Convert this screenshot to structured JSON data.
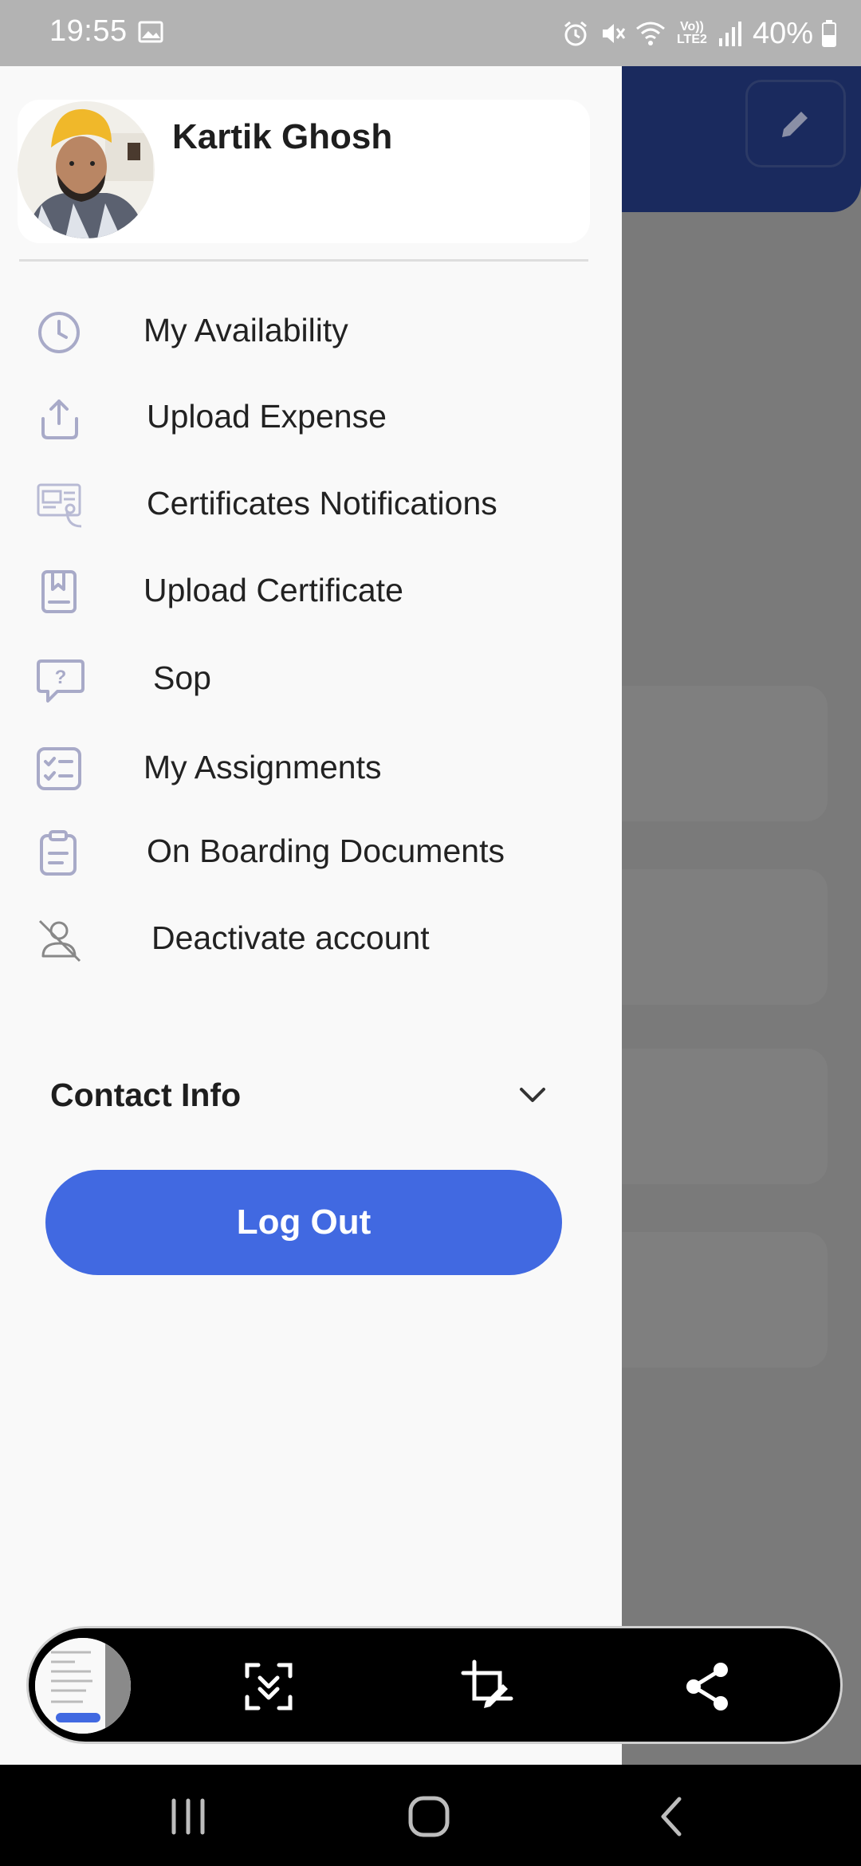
{
  "status_bar": {
    "time": "19:55",
    "battery": "40%",
    "network": "Vo)) LTE2",
    "icons": [
      "image-icon",
      "alarm-icon",
      "mute-icon",
      "wifi-icon",
      "signal-icon",
      "battery-icon"
    ]
  },
  "background_app": {
    "header_color": "#1a2a5e",
    "edit_icon": "pencil-icon"
  },
  "drawer": {
    "profile": {
      "name": "Kartik Ghosh",
      "avatar": "avatar-photo"
    },
    "menu": [
      {
        "label": "My Availability",
        "icon": "clock-icon"
      },
      {
        "label": "Upload Expense",
        "icon": "upload-icon"
      },
      {
        "label": "Certificates Notifications",
        "icon": "certificate-notification-icon"
      },
      {
        "label": "Upload Certificate",
        "icon": "certificate-icon"
      },
      {
        "label": "Sop",
        "icon": "help-chat-icon"
      },
      {
        "label": "My Assignments",
        "icon": "checklist-icon"
      },
      {
        "label": "On Boarding Documents",
        "icon": "clipboard-icon"
      },
      {
        "label": "Deactivate account",
        "icon": "user-off-icon"
      }
    ],
    "contact_info": {
      "label": "Contact Info",
      "icon": "chevron-down-icon"
    },
    "logout": {
      "label": "Log Out",
      "color": "#4169e1"
    }
  },
  "screenshot_toolbar": {
    "tools": [
      "scroll-capture-icon",
      "crop-edit-icon",
      "share-icon"
    ]
  },
  "nav_bar": {
    "buttons": [
      "recent-apps-icon",
      "home-icon",
      "back-icon"
    ]
  }
}
